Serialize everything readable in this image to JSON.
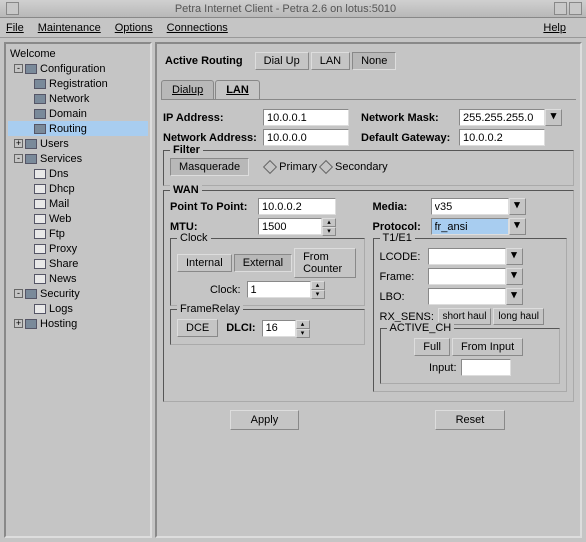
{
  "window": {
    "title": "Petra Internet Client - Petra 2.6 on lotus:5010"
  },
  "menu": {
    "file": "File",
    "maintenance": "Maintenance",
    "options": "Options",
    "connections": "Connections",
    "help": "Help"
  },
  "tree": {
    "welcome": "Welcome",
    "configuration": "Configuration",
    "registration": "Registration",
    "network": "Network",
    "domain": "Domain",
    "routing": "Routing",
    "users": "Users",
    "services": "Services",
    "dns": "Dns",
    "dhcp": "Dhcp",
    "mail": "Mail",
    "web": "Web",
    "ftp": "Ftp",
    "proxy": "Proxy",
    "share": "Share",
    "news": "News",
    "security": "Security",
    "logs": "Logs",
    "hosting": "Hosting"
  },
  "toolbar": {
    "active_routing": "Active Routing",
    "dial_up": "Dial Up",
    "lan": "LAN",
    "none": "None"
  },
  "tabs": {
    "dialup": "Dialup",
    "lan": "LAN"
  },
  "lan": {
    "ip_label": "IP Address:",
    "ip": "10.0.0.1",
    "mask_label": "Network Mask:",
    "mask": "255.255.255.0",
    "netaddr_label": "Network Address:",
    "netaddr": "10.0.0.0",
    "gw_label": "Default Gateway:",
    "gw": "10.0.0.2"
  },
  "filter": {
    "title": "Filter",
    "masquerade": "Masquerade",
    "primary": "Primary",
    "secondary": "Secondary"
  },
  "wan": {
    "title": "WAN",
    "ptp_label": "Point To Point:",
    "ptp": "10.0.0.2",
    "mtu_label": "MTU:",
    "mtu": "1500",
    "media_label": "Media:",
    "media": "v35",
    "protocol_label": "Protocol:",
    "protocol": "fr_ansi",
    "clock": {
      "title": "Clock",
      "internal": "Internal",
      "external": "External",
      "from_counter": "From Counter",
      "label": "Clock:",
      "value": "1"
    },
    "framerelay": {
      "title": "FrameRelay",
      "dce": "DCE",
      "dlci_label": "DLCI:",
      "dlci": "16"
    },
    "t1e1": {
      "title": "T1/E1",
      "lcode": "LCODE:",
      "frame": "Frame:",
      "lbo": "LBO:",
      "rx_sens": "RX_SENS:",
      "short_haul": "short haul",
      "long_haul": "long haul",
      "active_ch": "ACTIVE_CH",
      "full": "Full",
      "from_input": "From Input",
      "input": "Input:"
    }
  },
  "buttons": {
    "apply": "Apply",
    "reset": "Reset"
  }
}
